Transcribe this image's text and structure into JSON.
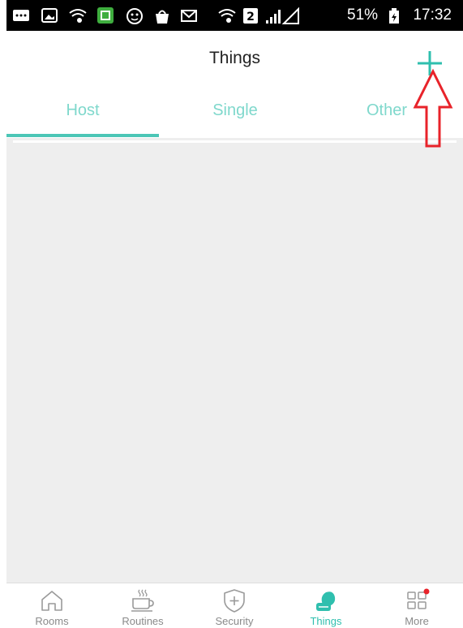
{
  "status_bar": {
    "battery": "51%",
    "time": "17:32",
    "icons": [
      "message-icon",
      "image-icon",
      "wifi-icon",
      "app-icon",
      "face-icon",
      "bag-icon",
      "mail-icon",
      "wifi-icon",
      "sim-icon",
      "signal-icon",
      "battery-icon"
    ]
  },
  "header": {
    "title": "Things",
    "add_icon": "plus-icon"
  },
  "tabs": [
    {
      "label": "Host",
      "active": true
    },
    {
      "label": "Single",
      "active": false
    },
    {
      "label": "Other",
      "active": false
    }
  ],
  "annotation": {
    "icon": "up-arrow-icon",
    "color": "#e8232a"
  },
  "bottom_nav": [
    {
      "label": "Rooms",
      "icon": "house-icon",
      "active": false
    },
    {
      "label": "Routines",
      "icon": "coffee-cup-icon",
      "active": false
    },
    {
      "label": "Security",
      "icon": "shield-plus-icon",
      "active": false
    },
    {
      "label": "Things",
      "icon": "things-icon",
      "active": true
    },
    {
      "label": "More",
      "icon": "grid-icon",
      "active": false,
      "badge": true
    }
  ],
  "colors": {
    "accent": "#2fbfae",
    "tab_text": "#7fd8cc",
    "content_bg": "#eeeeee",
    "badge": "#e8232a"
  }
}
